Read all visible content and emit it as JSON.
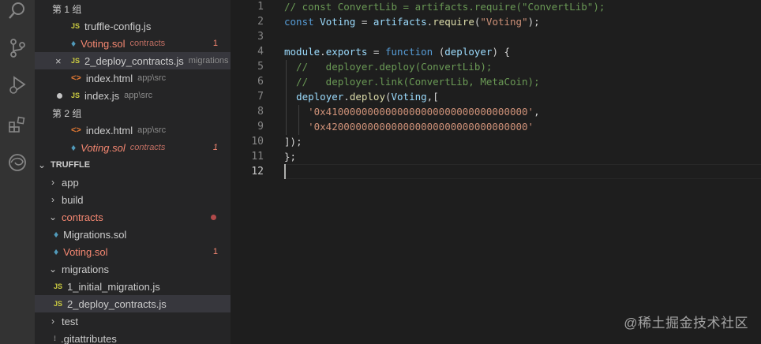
{
  "open_editors": {
    "groups": [
      {
        "label": "第 1 组",
        "files": [
          {
            "name": "truffle-config.js",
            "type": "JS",
            "desc": ""
          },
          {
            "name": "Voting.sol",
            "type": "sol",
            "desc": "contracts",
            "badge": "1"
          },
          {
            "name": "2_deploy_contracts.js",
            "type": "JS",
            "desc": "migrations",
            "close": "×"
          },
          {
            "name": "index.html",
            "type": "html",
            "desc": "app\\src"
          },
          {
            "name": "index.js",
            "type": "JS",
            "desc": "app\\src"
          }
        ]
      },
      {
        "label": "第 2 组",
        "files": [
          {
            "name": "index.html",
            "type": "html",
            "desc": "app\\src"
          },
          {
            "name": "Voting.sol",
            "type": "sol",
            "desc": "contracts",
            "badge": "1"
          }
        ]
      }
    ]
  },
  "explorer": {
    "title": "TRUFFLE",
    "items": [
      {
        "name": "app",
        "chevron": "›"
      },
      {
        "name": "build",
        "chevron": "›"
      },
      {
        "name": "contracts",
        "chevron": "⌄"
      },
      {
        "name": "Migrations.sol",
        "type": "sol"
      },
      {
        "name": "Voting.sol",
        "type": "sol",
        "badge": "1"
      },
      {
        "name": "migrations",
        "chevron": "⌄"
      },
      {
        "name": "1_initial_migration.js",
        "type": "JS"
      },
      {
        "name": "2_deploy_contracts.js",
        "type": "JS"
      },
      {
        "name": "test",
        "chevron": "›"
      },
      {
        "name": ".gitattributes"
      }
    ]
  },
  "editor": {
    "line_numbers": [
      "1",
      "2",
      "3",
      "4",
      "5",
      "6",
      "7",
      "8",
      "9",
      "10",
      "11",
      "12"
    ],
    "lines": [
      "// const ConvertLib = artifacts.require(\"ConvertLib\");",
      "const Voting = artifacts.require(\"Voting\");",
      "",
      "module.exports = function (deployer) {",
      "  //   deployer.deploy(ConvertLib);",
      "  //   deployer.link(ConvertLib, MetaCoin);",
      "  deployer.deploy(Voting,[",
      "    '0x4100000000000000000000000000000000',",
      "    '0x4200000000000000000000000000000000'",
      "]);",
      "};",
      ""
    ]
  },
  "watermark": "@稀土掘金技术社区",
  "colors": {
    "activity_bar": "#333333",
    "sidebar": "#252526",
    "editor": "#1e1e1e",
    "error": "#f48771",
    "js_icon": "#cbcb41",
    "html_icon": "#e37933",
    "sol_icon": "#519aba"
  }
}
